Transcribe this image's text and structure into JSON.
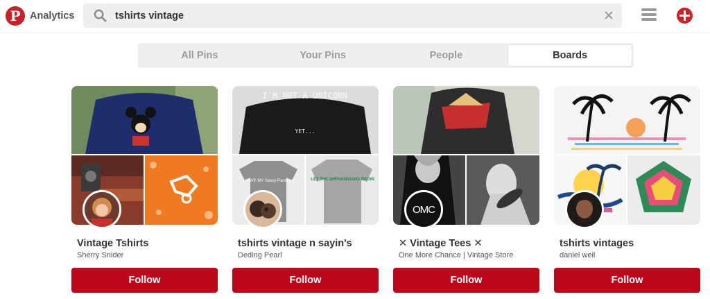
{
  "header": {
    "logo_letter": "P",
    "analytics_label": "Analytics",
    "search_value": "tshirts vintage"
  },
  "tabs": [
    {
      "label": "All Pins",
      "active": false
    },
    {
      "label": "Your Pins",
      "active": false
    },
    {
      "label": "People",
      "active": false
    },
    {
      "label": "Boards",
      "active": true
    }
  ],
  "boards": [
    {
      "title": "Vintage Tshirts",
      "owner": "Sherry Snider",
      "follow_label": "Follow"
    },
    {
      "title": "tshirts vintage n sayin's",
      "owner": "Deding Pearl",
      "follow_label": "Follow",
      "cover_text": "I'M NOT A UNICORN",
      "cover_sub": "YET...",
      "shirt1_text": "I HAVE MY Sassy Pants on",
      "shirt2_text": "LET THE SHENANIGANS BEGIN"
    },
    {
      "title": "✕ Vintage Tees ✕",
      "owner": "One More Chance | Vintage Store",
      "follow_label": "Follow",
      "avatar_text": "OMC"
    },
    {
      "title": "tshirts vintages",
      "owner": "daniel weil",
      "follow_label": "Follow"
    }
  ],
  "colors": {
    "brand_red": "#bd081c",
    "tab_bg": "#efefef"
  }
}
